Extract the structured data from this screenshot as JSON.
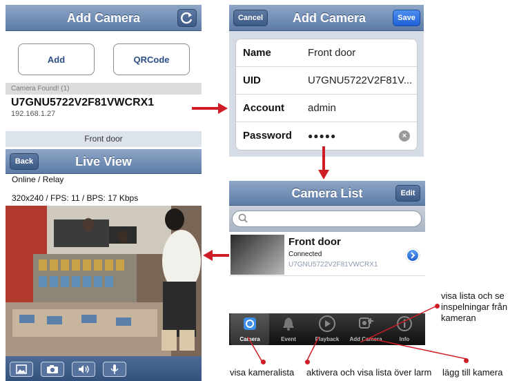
{
  "panel_add_camera_search": {
    "title": "Add Camera",
    "add_button": "Add",
    "qrcode_button": "QRCode",
    "found_header": "Camera Found! (1)",
    "found_uid": "U7GNU5722V2F81VWCRX1",
    "found_ip": "192.168.1.27"
  },
  "panel_add_camera_form": {
    "title": "Add Camera",
    "cancel_label": "Cancel",
    "save_label": "Save",
    "rows": [
      {
        "label": "Name",
        "value": "Front door"
      },
      {
        "label": "UID",
        "value": "U7GNU5722V2F81V..."
      },
      {
        "label": "Account",
        "value": "admin"
      },
      {
        "label": "Password",
        "value": "●●●●●"
      }
    ]
  },
  "panel_live_view": {
    "camera_name": "Front door",
    "title": "Live View",
    "back_label": "Back",
    "status": "Online / Relay",
    "stats": "320x240 / FPS: 11 / BPS: 17 Kbps"
  },
  "panel_camera_list": {
    "title": "Camera List",
    "edit_label": "Edit",
    "camera": {
      "name": "Front door",
      "status": "Connected",
      "uid": "U7GNU5722V2F81VWCRX1"
    },
    "tabs": [
      {
        "label": "Camera",
        "icon": "camera-icon"
      },
      {
        "label": "Event",
        "icon": "bell-icon"
      },
      {
        "label": "Playback",
        "icon": "play-icon"
      },
      {
        "label": "Add Camera",
        "icon": "add-camera-icon"
      },
      {
        "label": "Info",
        "icon": "info-icon"
      }
    ]
  },
  "annotations": {
    "playback_note": "visa lista och se\ninspelningar från\nkameran",
    "camera_note": "visa kameralista",
    "event_note": "aktivera och visa lista över larm",
    "addcam_note": "lägg till kamera"
  },
  "colors": {
    "navbar": "#6f8bb3",
    "arrow": "#d01d25",
    "accent_blue": "#2d4d86"
  }
}
